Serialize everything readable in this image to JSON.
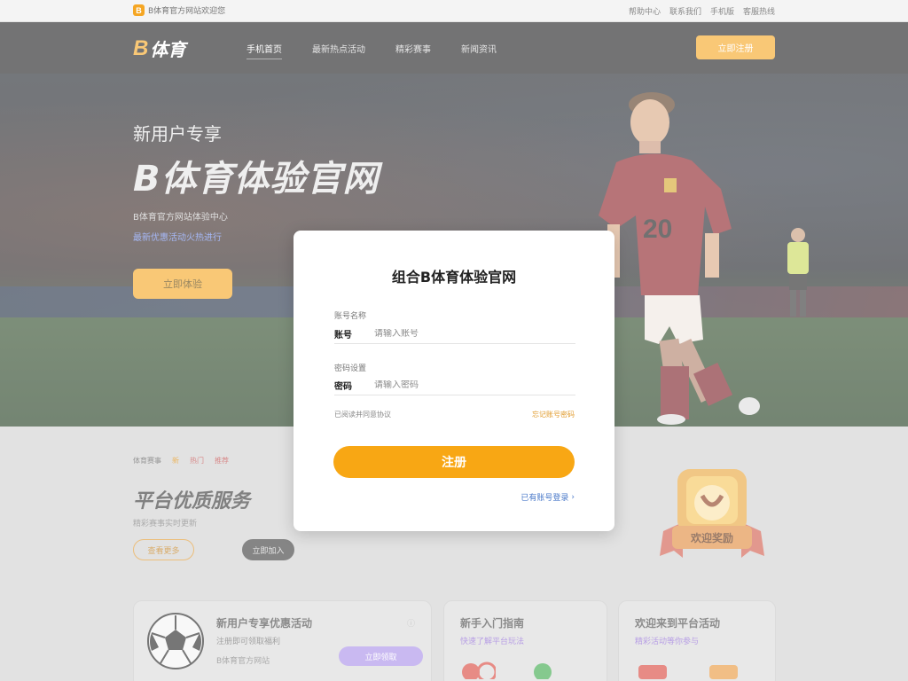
{
  "topbar": {
    "logo_letter": "B",
    "left_text": "B体育官方网站欢迎您",
    "right_links": [
      "帮助中心",
      "联系我们",
      "手机版",
      "客服热线"
    ]
  },
  "header": {
    "brand_letter": "B",
    "brand_name": "体育",
    "nav": [
      "手机首页",
      "最新热点活动",
      "精彩赛事",
      "新闻资讯"
    ],
    "cta_label": "立即注册"
  },
  "hero": {
    "subtitle": "新用户专享",
    "title": "B体育体验官网",
    "desc": "B体育官方网站体验中心",
    "desc2": "最新优惠活动火热进行",
    "button_label": "立即体验"
  },
  "modal": {
    "title": "组合B体育体验官网",
    "field1_label": "账号名称",
    "field1_prefix": "账号",
    "field1_placeholder": "请输入账号",
    "field2_label": "密码设置",
    "field2_prefix": "密码",
    "field2_placeholder": "请输入密码",
    "note": "已阅读并同意协议",
    "forgot_link": "忘记账号密码",
    "register_label": "注册",
    "login_link": "已有账号登录"
  },
  "section": {
    "tags": [
      "体育赛事",
      "新",
      "热门",
      "推荐"
    ],
    "title": "平台优质服务",
    "desc": "精彩赛事实时更新",
    "btn1": "查看更多",
    "btn2": "立即加入",
    "trophy_label": "欢迎奖励"
  },
  "cards": {
    "card1_title": "新用户专享优惠活动",
    "card1_sub": "注册即可领取福利",
    "card1_sub2": "B体育官方网站",
    "card1_btn": "立即领取",
    "card2_title": "新手入门指南",
    "card2_sub": "快速了解平台玩法",
    "card3_title": "欢迎来到平台活动",
    "card3_sub": "精彩活动等你参与"
  },
  "colors": {
    "accent": "#f5a623",
    "header_bg": "#1d1d1f",
    "register_btn": "#f8a714",
    "link_blue": "#4a79c9"
  }
}
